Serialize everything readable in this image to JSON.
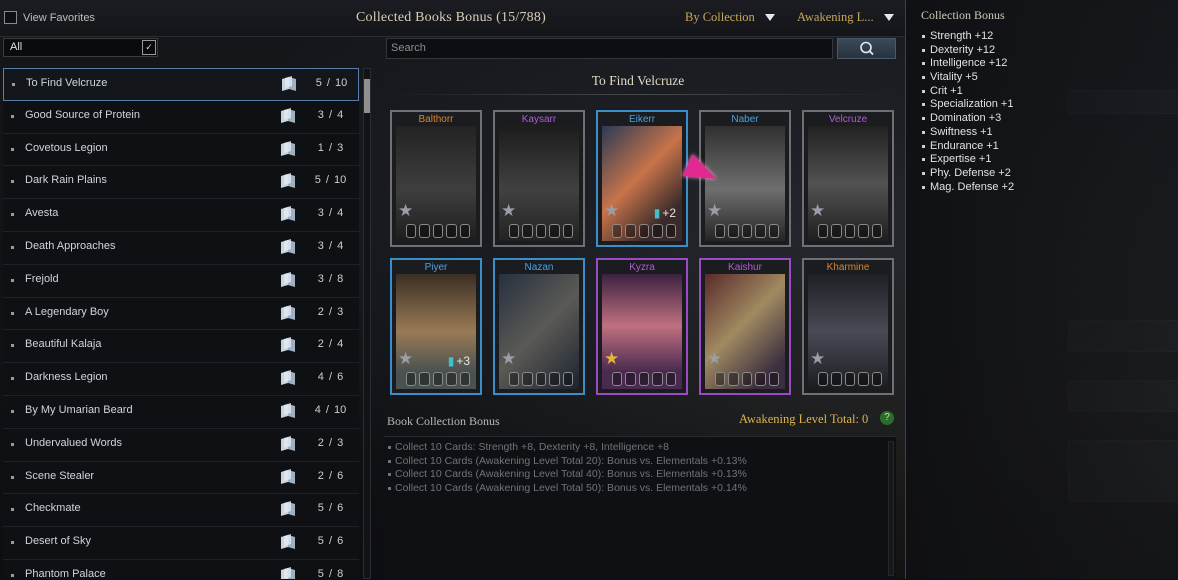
{
  "header": {
    "view_favorites": "View Favorites",
    "title": "Collected Books Bonus (15/788)",
    "sort_dropdown": "By Collection",
    "awakening_dropdown": "Awakening L..."
  },
  "filter": {
    "value": "All",
    "search_placeholder": "Search"
  },
  "collections": [
    {
      "name": "To Find Velcruze",
      "count": "5 / 10"
    },
    {
      "name": "Good Source of Protein",
      "count": "3 / 4"
    },
    {
      "name": "Covetous Legion",
      "count": "1 / 3"
    },
    {
      "name": "Dark Rain Plains",
      "count": "5 / 10"
    },
    {
      "name": "Avesta",
      "count": "3 / 4"
    },
    {
      "name": "Death Approaches",
      "count": "3 / 4"
    },
    {
      "name": "Frejold",
      "count": "3 / 8"
    },
    {
      "name": "A Legendary Boy",
      "count": "2 / 3"
    },
    {
      "name": "Beautiful Kalaja",
      "count": "2 / 4"
    },
    {
      "name": "Darkness Legion",
      "count": "4 / 6"
    },
    {
      "name": "By My Umarian Beard",
      "count": "4 / 10"
    },
    {
      "name": "Undervalued Words",
      "count": "2 / 3"
    },
    {
      "name": "Scene Stealer",
      "count": "2 / 6"
    },
    {
      "name": "Checkmate",
      "count": "5 / 6"
    },
    {
      "name": "Desert of Sky",
      "count": "5 / 6"
    },
    {
      "name": "Phantom Palace",
      "count": "5 / 8"
    }
  ],
  "selected_collection": "To Find Velcruze",
  "cards": [
    {
      "name": "Balthorr",
      "name_color": "#d8862a",
      "frame": "gray",
      "collected": false,
      "gold_star": false,
      "plus": ""
    },
    {
      "name": "Kaysarr",
      "name_color": "#b45ad6",
      "frame": "gray",
      "collected": false,
      "gold_star": false,
      "plus": ""
    },
    {
      "name": "Eikerr",
      "name_color": "#4aa3e0",
      "frame": "blue",
      "collected": true,
      "gold_star": false,
      "plus": "+2"
    },
    {
      "name": "Naber",
      "name_color": "#4aa3e0",
      "frame": "gray",
      "collected": false,
      "gold_star": false,
      "plus": ""
    },
    {
      "name": "Velcruze",
      "name_color": "#b45ad6",
      "frame": "gray",
      "collected": false,
      "gold_star": false,
      "plus": ""
    },
    {
      "name": "Piyer",
      "name_color": "#4aa3e0",
      "frame": "blue",
      "collected": true,
      "gold_star": false,
      "plus": "+3"
    },
    {
      "name": "Nazan",
      "name_color": "#4aa3e0",
      "frame": "blue",
      "collected": true,
      "gold_star": false,
      "plus": ""
    },
    {
      "name": "Kyzra",
      "name_color": "#b45ad6",
      "frame": "purple",
      "collected": true,
      "gold_star": true,
      "plus": ""
    },
    {
      "name": "Kaishur",
      "name_color": "#b45ad6",
      "frame": "purple",
      "collected": true,
      "gold_star": false,
      "plus": ""
    },
    {
      "name": "Kharmine",
      "name_color": "#d8862a",
      "frame": "gray",
      "collected": true,
      "gold_star": false,
      "plus": ""
    }
  ],
  "book_bonus": {
    "label": "Book Collection Bonus",
    "awakening_total": "Awakening Level Total: 0",
    "help": "?",
    "lines": [
      "Collect 10 Cards: Strength +8, Dexterity +8, Intelligence +8",
      "Collect 10 Cards (Awakening Level Total 20): Bonus vs. Elementals +0.13%",
      "Collect 10 Cards (Awakening Level Total 40): Bonus vs. Elementals +0.13%",
      "Collect 10 Cards (Awakening Level Total 50): Bonus vs. Elementals +0.14%"
    ]
  },
  "collection_bonus": {
    "title": "Collection Bonus",
    "stats": [
      "Strength +12",
      "Dexterity +12",
      "Intelligence +12",
      "Vitality +5",
      "Crit +1",
      "Specialization +1",
      "Domination +3",
      "Swiftness +1",
      "Endurance +1",
      "Expertise +1",
      "Phy. Defense +2",
      "Mag. Defense +2"
    ]
  }
}
